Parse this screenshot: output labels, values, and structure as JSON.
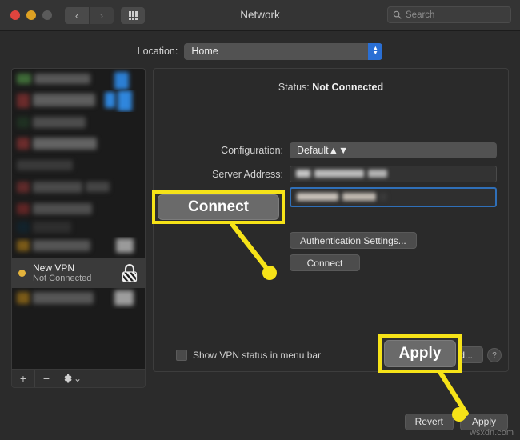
{
  "window": {
    "title": "Network",
    "traffic_lights": [
      "close-red",
      "minimize-yellow",
      "zoom-disabled"
    ],
    "nav_back_glyph": "‹",
    "nav_forward_glyph": "›",
    "grid_button_name": "show-all-preferences"
  },
  "search": {
    "placeholder": "Search",
    "value": ""
  },
  "location": {
    "label": "Location:",
    "value": "Home"
  },
  "sidebar": {
    "selected_service": {
      "name": "New VPN",
      "status": "Not Connected",
      "bullet_color": "#e4b33c",
      "icon": "vpn-lock-icon"
    },
    "toolbar": {
      "add": "+",
      "remove": "−",
      "action": "gear-icon",
      "action_chevron": "⌄"
    },
    "redacted_rows": 9
  },
  "panel": {
    "status_label": "Status:",
    "status_value": "Not Connected",
    "configuration_label": "Configuration:",
    "configuration_value": "Default",
    "server_address_label": "Server Address:",
    "server_address_value": "",
    "account_name_value": "",
    "auth_settings_button": "Authentication Settings...",
    "connect_button": "Connect",
    "show_status_checkbox_label": "Show VPN status in menu bar",
    "show_status_checked": false,
    "advanced_button": "Advanced...",
    "help_button": "?"
  },
  "footer": {
    "revert_button": "Revert",
    "apply_button": "Apply"
  },
  "annotations": {
    "highlight_color": "#f6e318",
    "callouts": [
      {
        "label": "Connect",
        "target": "connect-button"
      },
      {
        "label": "Apply",
        "target": "apply-button"
      }
    ]
  },
  "watermark": "wsxdn.com"
}
